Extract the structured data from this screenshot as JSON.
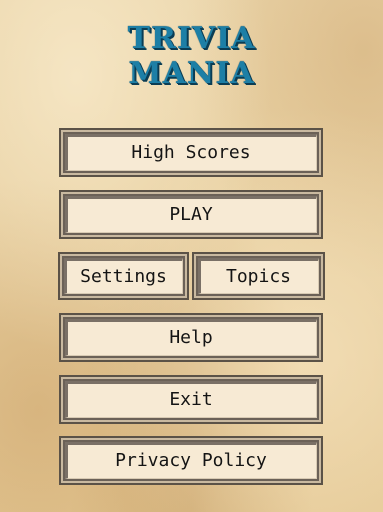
{
  "title": {
    "line1": "TRIVIA",
    "line2": "MANIA"
  },
  "menu": {
    "high_scores": "High Scores",
    "play": "PLAY",
    "settings": "Settings",
    "topics": "Topics",
    "help": "Help",
    "exit": "Exit",
    "privacy_policy": "Privacy Policy"
  },
  "colors": {
    "title": "#1d7fa6",
    "title_outline": "#0b3d54",
    "button_face": "#f7ead4",
    "button_border": "#5b5247",
    "parchment": "#e7cfa0"
  }
}
